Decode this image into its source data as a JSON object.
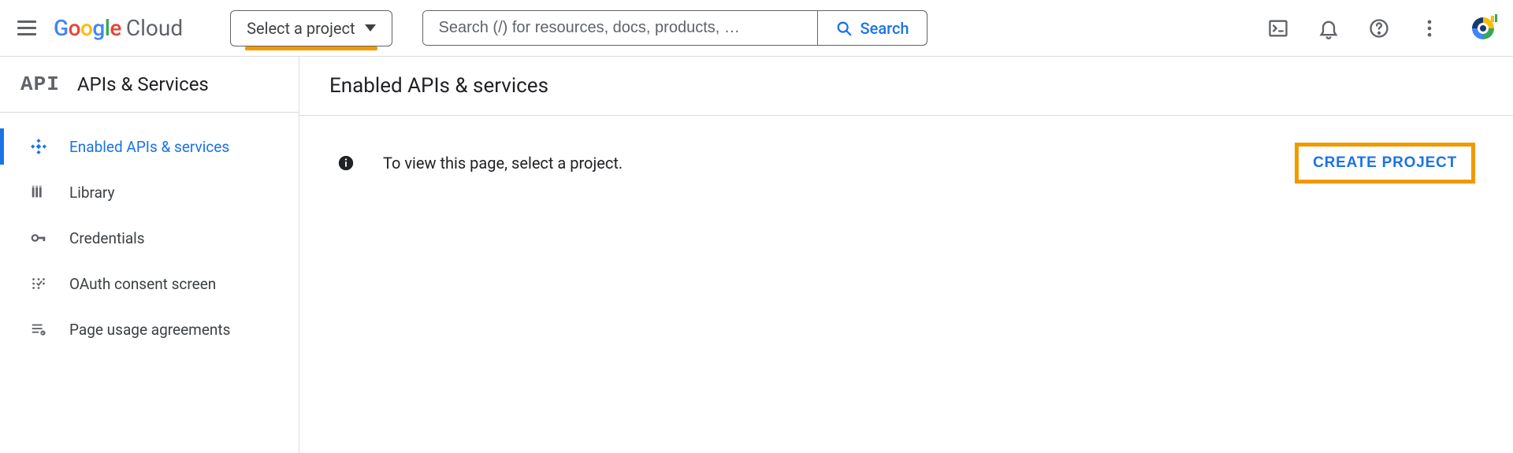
{
  "header": {
    "logo_google": "Google",
    "logo_cloud": "Cloud",
    "project_selector_label": "Select a project",
    "search_placeholder": "Search (/) for resources, docs, products, …",
    "search_button_label": "Search"
  },
  "sidebar": {
    "logo": "API",
    "title": "APIs & Services",
    "items": [
      {
        "label": "Enabled APIs & services",
        "icon": "enabled-apis-icon",
        "active": true
      },
      {
        "label": "Library",
        "icon": "library-icon",
        "active": false
      },
      {
        "label": "Credentials",
        "icon": "key-icon",
        "active": false
      },
      {
        "label": "OAuth consent screen",
        "icon": "consent-icon",
        "active": false
      },
      {
        "label": "Page usage agreements",
        "icon": "agreements-icon",
        "active": false
      }
    ]
  },
  "main": {
    "title": "Enabled APIs & services",
    "info_message": "To view this page, select a project.",
    "create_project_label": "CREATE PROJECT"
  },
  "colors": {
    "accent_blue": "#1a73e8",
    "highlight_orange": "#f29900"
  }
}
